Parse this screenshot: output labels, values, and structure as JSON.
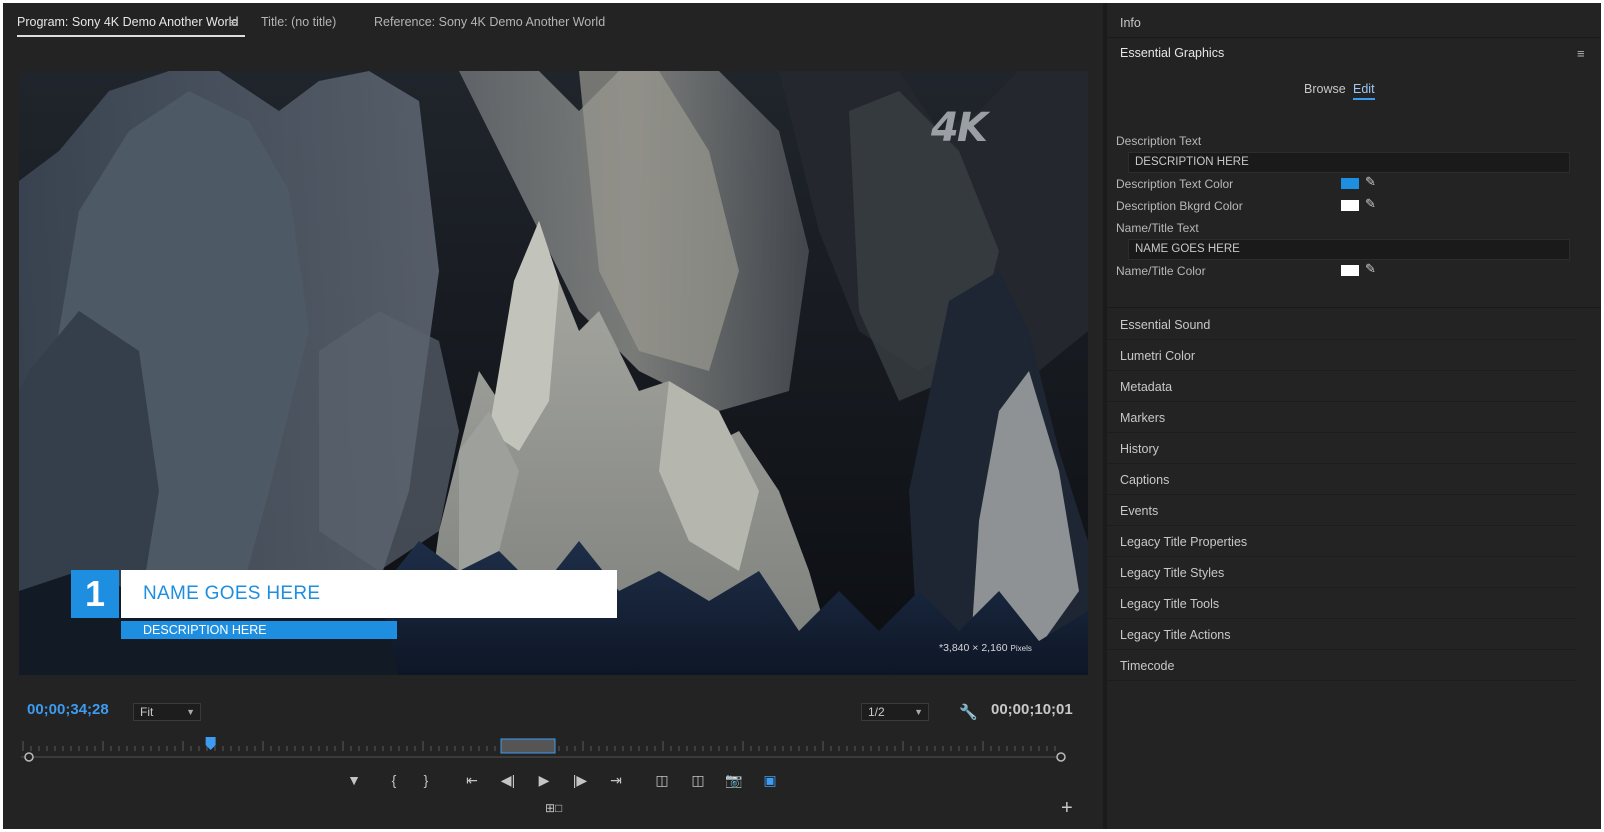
{
  "monitor": {
    "tabs": [
      {
        "label": "Program: Sony 4K Demo  Another World",
        "active": true
      },
      {
        "label": "Title: (no title)",
        "active": false
      },
      {
        "label": "Reference: Sony 4K Demo  Another World",
        "active": false
      }
    ],
    "menu_glyph": "≡",
    "video": {
      "badge": "4K",
      "resolution_text": "*3,840 × 2,160",
      "resolution_unit": "Pixels"
    },
    "lower_third": {
      "number": "1",
      "name": "NAME GOES HERE",
      "description": "DESCRIPTION HERE",
      "accent_color": "#1e8fe0"
    },
    "current_timecode": "00;00;34;28",
    "duration_timecode": "00;00;10;01",
    "zoom_select": "Fit",
    "resolution_select": "1/2",
    "playhead_fraction": 0.176,
    "transport_icons": [
      "marker-icon",
      "mark-in-icon",
      "mark-out-icon",
      "go-to-in-icon",
      "step-back-icon",
      "play-icon",
      "step-forward-icon",
      "go-to-out-icon",
      "lift-icon",
      "extract-icon",
      "export-frame-icon",
      "comparison-view-icon"
    ]
  },
  "info": {
    "title": "Info"
  },
  "essential_graphics": {
    "title": "Essential Graphics",
    "menu_glyph": "≡",
    "tabs": [
      {
        "label": "Browse",
        "active": false
      },
      {
        "label": "Edit",
        "active": true
      }
    ],
    "properties": {
      "description_text_label": "Description Text",
      "description_text_value": "DESCRIPTION HERE",
      "description_color_label": "Description Text Color",
      "description_color": "#1e8fe0",
      "description_bkgrd_label": "Description Bkgrd Color",
      "description_bkgrd_color": "#ffffff",
      "name_text_label": "Name/Title Text",
      "name_text_value": "NAME GOES HERE",
      "name_color_label": "Name/Title Color",
      "name_color": "#ffffff"
    }
  },
  "panels": [
    "Essential Sound",
    "Lumetri Color",
    "Metadata",
    "Markers",
    "History",
    "Captions",
    "Events",
    "Legacy Title Properties",
    "Legacy Title Styles",
    "Legacy Title Tools",
    "Legacy Title Actions",
    "Timecode"
  ],
  "colors": {
    "accent": "#3d9bf0",
    "panel_bg": "#232323",
    "timecode_blue": "#3d9bf0"
  }
}
